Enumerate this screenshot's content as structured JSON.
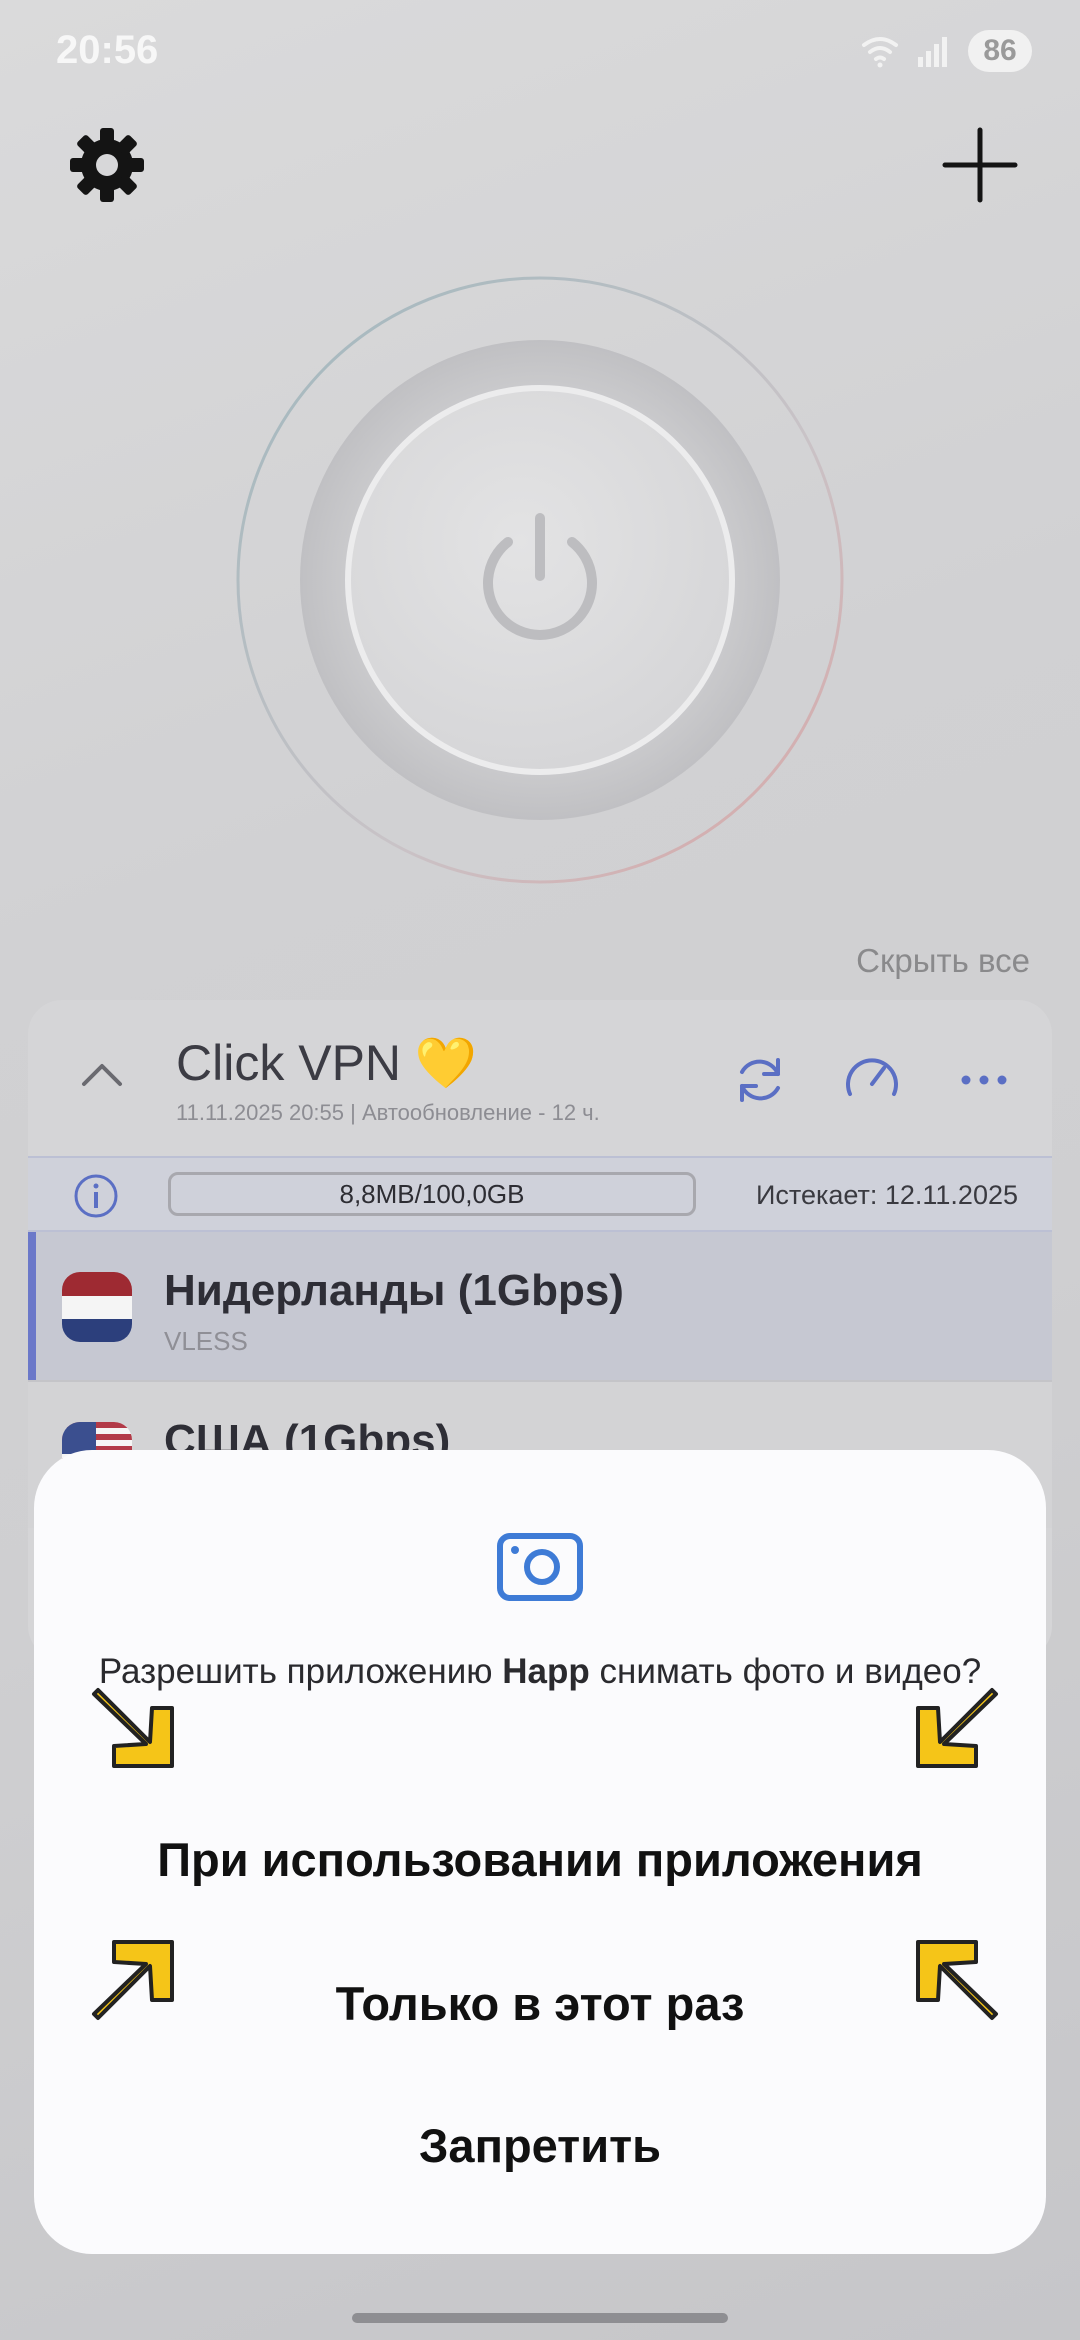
{
  "status_bar": {
    "time": "20:56",
    "battery": "86",
    "icons": [
      "wifi-icon",
      "signal-icon"
    ]
  },
  "app": {
    "hide_all_label": "Скрыть все",
    "subscription": {
      "title": "Click VPN 💛",
      "updated": "11.11.2025 20:55 | Автообновление - 12 ч.",
      "traffic": "8,8MB/100,0GB",
      "expires": "Истекает: 12.11.2025"
    },
    "servers": [
      {
        "name": "Нидерланды (1Gbps)",
        "protocol": "VLESS",
        "flag": "netherlands-flag",
        "selected": true
      },
      {
        "name": "США (1Gbps)",
        "protocol": "",
        "flag": "usa-flag",
        "selected": false
      }
    ]
  },
  "dialog": {
    "prompt_before": "Разрешить приложению ",
    "app_name": "Happ",
    "prompt_after": " снимать фото и видео?",
    "option_while_using": "При использовании приложения",
    "option_once": "Только в этот раз",
    "option_deny": "Запретить",
    "annotation_arrow_color": "#f5c518"
  },
  "colors": {
    "accent": "#4a7fd6",
    "selected_bar": "#6b78c9"
  }
}
